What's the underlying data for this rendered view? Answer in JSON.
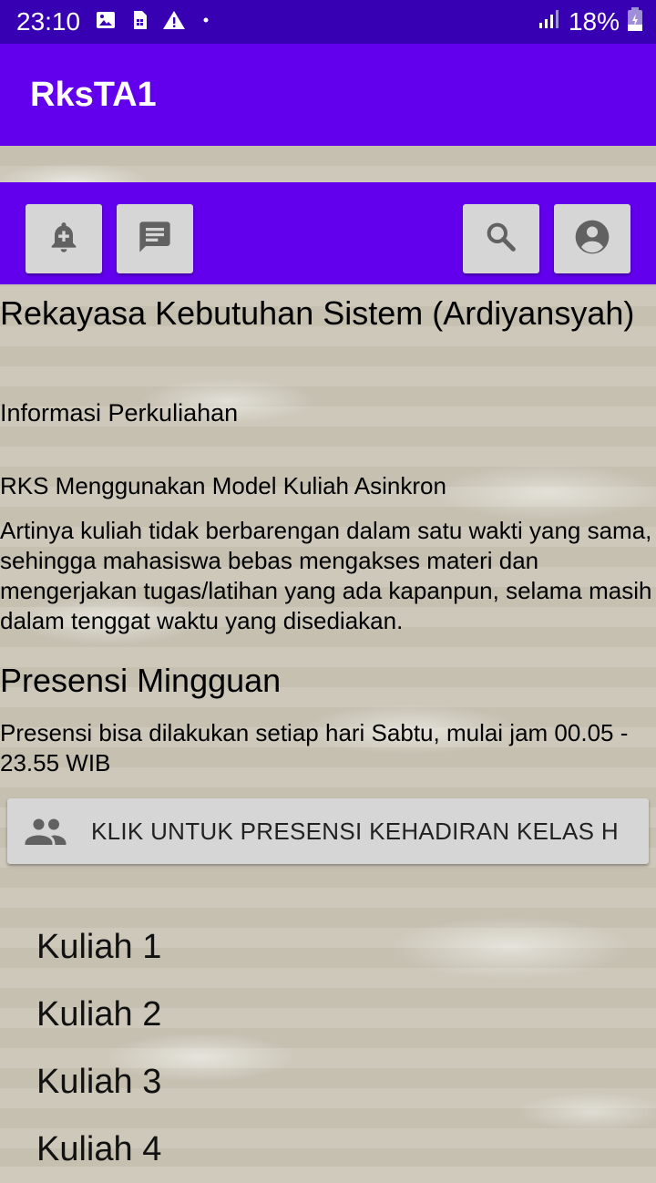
{
  "status_bar": {
    "time": "23:10",
    "battery": "18%",
    "icons": [
      "image-icon",
      "sim-icon",
      "warning-icon",
      "dot-icon",
      "signal-icon",
      "battery-icon"
    ]
  },
  "app_bar": {
    "title": "RksTA1"
  },
  "toolbar": {
    "buttons": [
      "add-alert-icon",
      "message-icon",
      "search-icon",
      "account-icon"
    ]
  },
  "content": {
    "course_title": "Rekayasa Kebutuhan Sistem (Ardiyansyah)",
    "info_label": "Informasi Perkuliahan",
    "model_label": "RKS Menggunakan Model Kuliah Asinkron",
    "description": "Artinya kuliah tidak berbarengan dalam satu wakti yang sama, sehingga mahasiswa bebas mengakses materi dan mengerjakan tugas/latihan yang ada kapanpun, selama masih dalam tenggat waktu yang disediakan.",
    "presensi_title": "Presensi Mingguan",
    "presensi_desc": "Presensi bisa dilakukan setiap hari Sabtu, mulai jam 00.05 - 23.55 WIB",
    "presensi_button": "KLIK UNTUK PRESENSI KEHADIRAN KELAS H",
    "kuliah": [
      "Kuliah 1",
      "Kuliah 2",
      "Kuliah 3",
      "Kuliah 4"
    ]
  },
  "colors": {
    "status_bar": "#3700b3",
    "primary": "#6200ee",
    "button": "#d6d6d6",
    "icon": "#616161"
  }
}
